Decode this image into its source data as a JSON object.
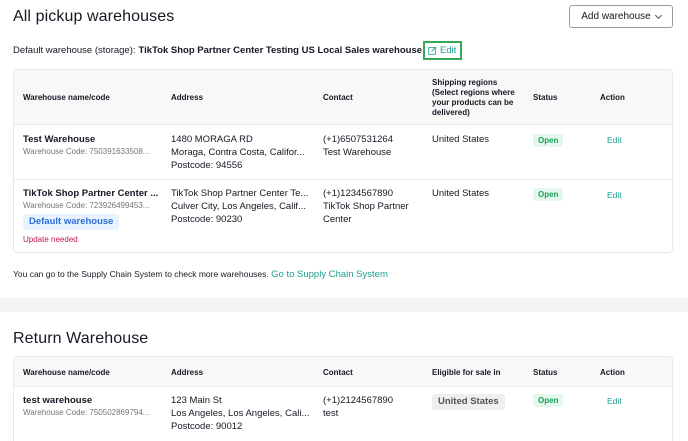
{
  "pickup": {
    "title": "All pickup warehouses",
    "add_button_label": "Add warehouse",
    "default_prefix": "Default warehouse (storage):",
    "default_name": "TikTok Shop Partner Center Testing US Local Sales warehouse",
    "default_edit_label": "Edit",
    "columns": [
      "Warehouse name/code",
      "Address",
      "Contact",
      "Shipping regions (Select regions where your products can be delivered)",
      "Status",
      "Action"
    ],
    "rows": [
      {
        "name": "Test Warehouse",
        "code": "Warehouse Code: 750391633508...",
        "address_line1": "1480 MORAGA RD",
        "address_line2": "Moraga, Contra Costa, Califor...",
        "postcode": "Postcode: 94556",
        "contact_phone": "(+1)6507531264",
        "contact_name": "Test Warehouse",
        "contact_name2": "",
        "region": "United States",
        "status": "Open",
        "action": "Edit",
        "default_badge": "",
        "update_note": ""
      },
      {
        "name": "TikTok Shop Partner Center ...",
        "code": "Warehouse Code: 723926499453...",
        "address_line1": "TikTok Shop Partner Center Te...",
        "address_line2": "Culver City, Los Angeles, Calif...",
        "postcode": "Postcode: 90230",
        "contact_phone": "(+1)1234567890",
        "contact_name": "TikTok Shop Partner",
        "contact_name2": "Center",
        "region": "United States",
        "status": "Open",
        "action": "Edit",
        "default_badge": "Default warehouse",
        "update_note": "Update needed"
      }
    ],
    "supply_text": "You can go to the Supply Chain System to check more warehouses.",
    "supply_link": "Go to Supply Chain System"
  },
  "return": {
    "title": "Return Warehouse",
    "columns": [
      "Warehouse name/code",
      "Address",
      "Contact",
      "Eligible for sale in",
      "Status",
      "Action"
    ],
    "rows": [
      {
        "name": "test warehouse",
        "code": "Warehouse Code: 750502869794...",
        "address_line1": "123 Main St",
        "address_line2": "Los Angeles, Los Angeles, Cali...",
        "postcode": "Postcode: 90012",
        "contact_phone": "(+1)2124567890",
        "contact_name": "test",
        "eligible": "United States",
        "status": "Open",
        "action": "Edit"
      }
    ]
  },
  "icons": {
    "edit": "edit-icon",
    "dropdown": "chevron-down-icon"
  },
  "colors": {
    "link": "#1a9e8f",
    "highlight": "#35a856",
    "open_bg": "#e6f7ee",
    "open_text": "#18a058",
    "default_badge_bg": "#e8f3ff",
    "update_needed": "#c2185b"
  }
}
